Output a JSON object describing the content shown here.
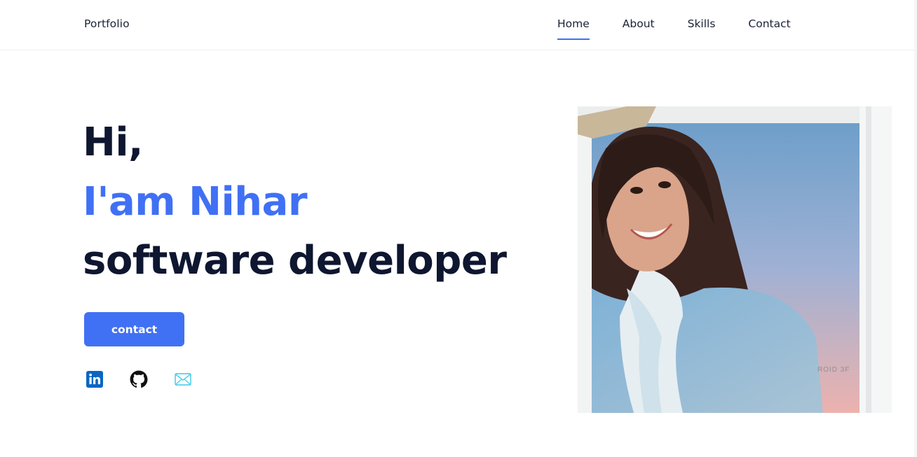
{
  "header": {
    "logo": "Portfolio",
    "nav": [
      {
        "label": "Home",
        "active": true
      },
      {
        "label": "About",
        "active": false
      },
      {
        "label": "Skills",
        "active": false
      },
      {
        "label": "Contact",
        "active": false
      }
    ]
  },
  "hero": {
    "greeting": "Hi,",
    "name_line": "I'am Nihar",
    "role_line": "software developer",
    "cta_label": "contact"
  },
  "socials": [
    {
      "icon": "linkedin-icon"
    },
    {
      "icon": "github-icon"
    },
    {
      "icon": "mail-icon"
    }
  ],
  "photo": {
    "alt": "Portrait photo",
    "frame_text": "ROID 3F"
  },
  "colors": {
    "accent": "#4070f4",
    "heading": "#0e1630",
    "linkedin": "#0a66c2",
    "mail": "#3cc8e6"
  }
}
